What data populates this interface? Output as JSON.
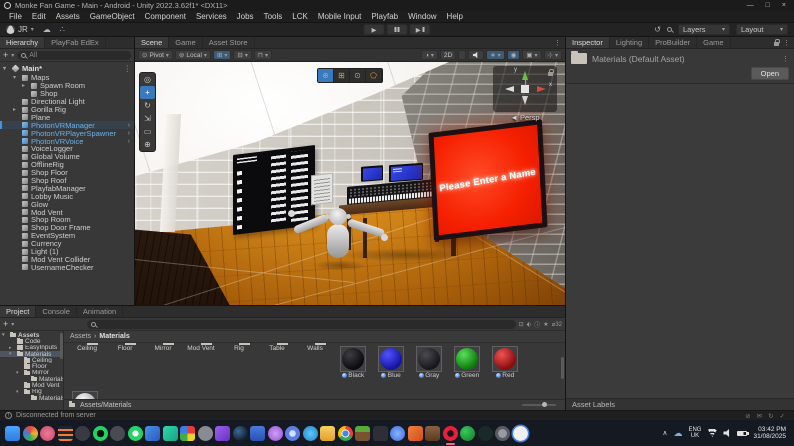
{
  "window": {
    "title": "Monke Fan Game - Main - Android - Unity 2022.3.62f1* <DX11>",
    "controls": {
      "minimize": "—",
      "maximize": "□",
      "close": "×"
    }
  },
  "menubar": [
    "File",
    "Edit",
    "Assets",
    "GameObject",
    "Component",
    "Services",
    "Jobs",
    "Tools",
    "LCK",
    "Mobile Input",
    "Playfab",
    "Window",
    "Help"
  ],
  "toolbar": {
    "account_label": "JR",
    "layers_label": "Layers",
    "layout_label": "Layout"
  },
  "hierarchy": {
    "tabs": [
      {
        "label": "Hierarchy",
        "cls": "active"
      },
      {
        "label": "PlayFab EdEx",
        "cls": ""
      }
    ],
    "search_text": "All",
    "scene_name": "Main*",
    "items": [
      {
        "label": "Maps",
        "cls": "i1",
        "arrow": "▾",
        "chev": ""
      },
      {
        "label": "Spawn Room",
        "cls": "i2",
        "arrow": "▸",
        "chev": ""
      },
      {
        "label": "Shop",
        "cls": "i2",
        "arrow": "",
        "chev": ""
      },
      {
        "label": "Directional Light",
        "cls": "i1",
        "arrow": "",
        "chev": ""
      },
      {
        "label": "Gorilla Rig",
        "cls": "i1",
        "arrow": "▸",
        "chev": ""
      },
      {
        "label": "Plane",
        "cls": "i1",
        "arrow": "",
        "chev": ""
      },
      {
        "label": "PhotonVRManager",
        "cls": "i1 blue sel",
        "arrow": "",
        "chev": "›"
      },
      {
        "label": "PhotonVRPlayerSpawner",
        "cls": "i1 blue",
        "arrow": "",
        "chev": "›"
      },
      {
        "label": "PhotonVRVoice",
        "cls": "i1 blue",
        "arrow": "",
        "chev": "›"
      },
      {
        "label": "VoiceLogger",
        "cls": "i1",
        "arrow": "",
        "chev": ""
      },
      {
        "label": "Global Volume",
        "cls": "i1",
        "arrow": "",
        "chev": ""
      },
      {
        "label": "OfflineRig",
        "cls": "i1",
        "arrow": "",
        "chev": ""
      },
      {
        "label": "Shop Floor",
        "cls": "i1",
        "arrow": "",
        "chev": ""
      },
      {
        "label": "Shop Roof",
        "cls": "i1",
        "arrow": "",
        "chev": ""
      },
      {
        "label": "PlayfabManager",
        "cls": "i1",
        "arrow": "",
        "chev": ""
      },
      {
        "label": "Lobby Music",
        "cls": "i1",
        "arrow": "",
        "chev": ""
      },
      {
        "label": "Glow",
        "cls": "i1",
        "arrow": "",
        "chev": ""
      },
      {
        "label": "Mod Vent",
        "cls": "i1",
        "arrow": "",
        "chev": ""
      },
      {
        "label": "Shop Room",
        "cls": "i1",
        "arrow": "",
        "chev": ""
      },
      {
        "label": "Shop Door Frame",
        "cls": "i1",
        "arrow": "",
        "chev": ""
      },
      {
        "label": "EventSystem",
        "cls": "i1",
        "arrow": "",
        "chev": ""
      },
      {
        "label": "Currency",
        "cls": "i1",
        "arrow": "",
        "chev": ""
      },
      {
        "label": "Light (1)",
        "cls": "i1",
        "arrow": "",
        "chev": ""
      },
      {
        "label": "Mod Vent Collider",
        "cls": "i1",
        "arrow": "",
        "chev": ""
      },
      {
        "label": "UsernameChecker",
        "cls": "i1",
        "arrow": "",
        "chev": ""
      }
    ]
  },
  "scene_view": {
    "tabs": [
      {
        "label": "Scene",
        "cls": "active"
      },
      {
        "label": "Game",
        "cls": ""
      },
      {
        "label": "Asset Store",
        "cls": ""
      }
    ],
    "pivot_label": "Pivot",
    "local_label": "Local",
    "mode_2d_label": "2D",
    "persp_label": "◄ Persp",
    "gizmo_y": "y",
    "gizmo_x": "x",
    "screen_text": "Please Enter a Name",
    "probuilder_buttons": [
      {
        "name": "object-mode-button",
        "glyph": "⊕",
        "cls": "sel"
      },
      {
        "name": "vertex-mode-button",
        "glyph": "⊞",
        "cls": ""
      },
      {
        "name": "edge-mode-button",
        "glyph": "⊙",
        "cls": ""
      },
      {
        "name": "face-mode-button",
        "glyph": "⬠",
        "cls": ""
      }
    ],
    "tool_buttons": [
      {
        "name": "view-tool-button",
        "glyph": "◎",
        "cls": ""
      },
      {
        "name": "move-tool-button",
        "glyph": "+",
        "cls": "sel"
      },
      {
        "name": "rotate-tool-button",
        "glyph": "↻",
        "cls": ""
      },
      {
        "name": "scale-tool-button",
        "glyph": "⇲",
        "cls": ""
      },
      {
        "name": "rect-tool-button",
        "glyph": "▭",
        "cls": ""
      },
      {
        "name": "transform-tool-button",
        "glyph": "⊕",
        "cls": ""
      }
    ]
  },
  "inspector": {
    "tabs": [
      {
        "label": "Inspector",
        "cls": "active"
      },
      {
        "label": "Lighting",
        "cls": ""
      },
      {
        "label": "ProBuilder",
        "cls": ""
      },
      {
        "label": "Game",
        "cls": ""
      }
    ],
    "asset_title": "Materials (Default Asset)",
    "open_label": "Open",
    "footer_label": "Asset Labels"
  },
  "project": {
    "tabs": [
      {
        "label": "Project",
        "cls": "active"
      },
      {
        "label": "Console",
        "cls": ""
      },
      {
        "label": "Animation",
        "cls": ""
      }
    ],
    "hidden_count": "32",
    "tree": [
      {
        "label": "Assets",
        "cls": "t0 bold",
        "arrow": "▾"
      },
      {
        "label": "Code",
        "cls": "t1",
        "arrow": ""
      },
      {
        "label": "EasyInputs",
        "cls": "t1",
        "arrow": "▸"
      },
      {
        "label": "Materials",
        "cls": "t1 sel",
        "arrow": "▾"
      },
      {
        "label": "Ceiling",
        "cls": "t2",
        "arrow": ""
      },
      {
        "label": "Floor",
        "cls": "t2",
        "arrow": ""
      },
      {
        "label": "Mirror",
        "cls": "t2",
        "arrow": "▾"
      },
      {
        "label": "Materials",
        "cls": "t3",
        "arrow": ""
      },
      {
        "label": "Mod Vent",
        "cls": "t2",
        "arrow": ""
      },
      {
        "label": "Rig",
        "cls": "t2",
        "arrow": "▾"
      },
      {
        "label": "Materials",
        "cls": "t3",
        "arrow": ""
      }
    ],
    "breadcrumb": {
      "root": "Assets",
      "sep": "›",
      "current": "Materials"
    },
    "folders": [
      {
        "name": "Ceiling"
      },
      {
        "name": "Floor"
      },
      {
        "name": "Mirror"
      },
      {
        "name": "Mod Vent"
      },
      {
        "name": "Rig"
      },
      {
        "name": "Table"
      },
      {
        "name": "Walls"
      }
    ],
    "materials": [
      {
        "name": "Black",
        "bg": "radial-gradient(circle at 35% 30%, #3c3c42, #0b0b0f 70%)"
      },
      {
        "name": "Blue",
        "bg": "radial-gradient(circle at 35% 30%, #5252ff, #14149e 70%)"
      },
      {
        "name": "Gray",
        "bg": "radial-gradient(circle at 35% 30%, #4a4a50, #17171b 70%)"
      },
      {
        "name": "Green",
        "bg": "radial-gradient(circle at 35% 30%, #58e058, #0d780d 70%)"
      },
      {
        "name": "Red",
        "bg": "radial-gradient(circle at 35% 30%, #f05252, #880d0d 70%)"
      }
    ],
    "path": "Assets/Materials"
  },
  "statusbar": {
    "message": "Disconnected from server",
    "icons": [
      {
        "name": "mute-icon",
        "glyph": "⊘"
      },
      {
        "name": "message-icon",
        "glyph": "✉"
      },
      {
        "name": "refresh-icon",
        "glyph": "↻"
      },
      {
        "name": "status-check-icon",
        "glyph": "✓"
      }
    ]
  },
  "taskbar": {
    "icons": [
      {
        "name": "start-button",
        "bg": "linear-gradient(#4da3ff,#2f7de0)",
        "cls": "sq"
      },
      {
        "name": "colorful-app-icon",
        "bg": "conic-gradient(#e84a3a,#f0b32e,#3fae4a,#3a7de8,#e84a3a)",
        "cls": "ci"
      },
      {
        "name": "game-controller-app-icon",
        "bg": "radial-gradient(circle,#f07898,#c04868)",
        "cls": "ci"
      },
      {
        "name": "orange-list-app-icon",
        "bg": "repeating-linear-gradient(0deg,#f08030 0 2px,#20242e 2px 5px)",
        "cls": "sq"
      },
      {
        "name": "dim-app-icon",
        "bg": "#3a3a44",
        "cls": "ci"
      },
      {
        "name": "spotify-icon",
        "bg": "radial-gradient(circle,#0c0c0c 34%,#1ed760 36%)",
        "cls": "ci"
      },
      {
        "name": "crosshair-app-icon",
        "bg": "#4a4a54",
        "cls": "ci"
      },
      {
        "name": "whatsapp-icon",
        "bg": "radial-gradient(circle,#ffffff 28%,#25d366 30%)",
        "cls": "ci"
      },
      {
        "name": "photos-app-icon",
        "bg": "linear-gradient(135deg,#4a90e8,#2a5ac0)",
        "cls": "sq"
      },
      {
        "name": "capture-app-icon",
        "bg": "linear-gradient(135deg,#30d8b0,#18a080)",
        "cls": "sq"
      },
      {
        "name": "rubiks-cube-app-icon",
        "bg": "conic-gradient(#e83a3a 0 25%,#f0d02e 0 50%,#3fae4a 0 75%,#3a7de8 0)",
        "cls": "sq"
      },
      {
        "name": "grey-app-icon",
        "bg": "#8a8a94",
        "cls": "ci"
      },
      {
        "name": "purple-triangle-app-icon",
        "bg": "linear-gradient(135deg,#9a60f0,#6a30c0)",
        "cls": "sq"
      },
      {
        "name": "steam-icon",
        "bg": "radial-gradient(circle at 35% 35%,#3a6a9a,#14202e 70%)",
        "cls": "ci"
      },
      {
        "name": "blue-app-icon",
        "bg": "linear-gradient(#4a7ae0,#2850b0)",
        "cls": "sq"
      },
      {
        "name": "purple-app-icon",
        "bg": "radial-gradient(circle,#d0a0f8,#9050d0)",
        "cls": "ci"
      },
      {
        "name": "cloud-app-icon",
        "bg": "radial-gradient(circle,#cfe2ff 30%,#5a7de8 32%)",
        "cls": "ci"
      },
      {
        "name": "mail-app-icon",
        "bg": "radial-gradient(circle,#60c8f8,#2080c8)",
        "cls": "ci"
      },
      {
        "name": "file-explorer-icon",
        "bg": "linear-gradient(#f8d060,#e0a030)",
        "cls": "sq"
      },
      {
        "name": "chrome-icon",
        "bg": "radial-gradient(circle,#4285f4 0 28%,#fff 30% 36%,transparent 38%),conic-gradient(#ea4335 0 33%,#34a853 0 66%,#fbbc05 0)",
        "cls": "ci"
      },
      {
        "name": "minecraft-icon",
        "bg": "linear-gradient(#5aaa3a 0 40%,#7a5230 40%)",
        "cls": "sq"
      },
      {
        "name": "recorder-app-icon",
        "bg": "#2e2e38",
        "cls": "sq"
      },
      {
        "name": "person-app-icon",
        "bg": "radial-gradient(circle,#8ab4f8,#3a6ae0)",
        "cls": "ci"
      },
      {
        "name": "orange-app-icon",
        "bg": "linear-gradient(135deg,#f08040,#d05018)",
        "cls": "sq"
      },
      {
        "name": "block-app-icon",
        "bg": "linear-gradient(#8a6240,#5a3a20)",
        "cls": "sq"
      },
      {
        "name": "opera-gx-icon",
        "bg": "radial-gradient(circle,#16161c 30%,#e8203a 32%)",
        "cls": "ci active"
      },
      {
        "name": "xbox-icon",
        "bg": "radial-gradient(circle at 35% 35%,#3ac85a,#107a28)",
        "cls": "ci"
      },
      {
        "name": "teal-app-icon",
        "bg": "#1a2a2a",
        "cls": "ci"
      },
      {
        "name": "settings-app-icon",
        "bg": "radial-gradient(circle,#9a9aa4 40%,#5a5a64 42%)",
        "cls": "ci"
      },
      {
        "name": "epic-app-icon",
        "bg": "radial-gradient(circle,#f0f0f4 60%,#c8c8d0)",
        "cls": "ci ring"
      }
    ],
    "tray": {
      "language_line1": "ENG",
      "language_line2": "UK",
      "time": "03:42 PM",
      "date": "31/08/2025"
    }
  }
}
